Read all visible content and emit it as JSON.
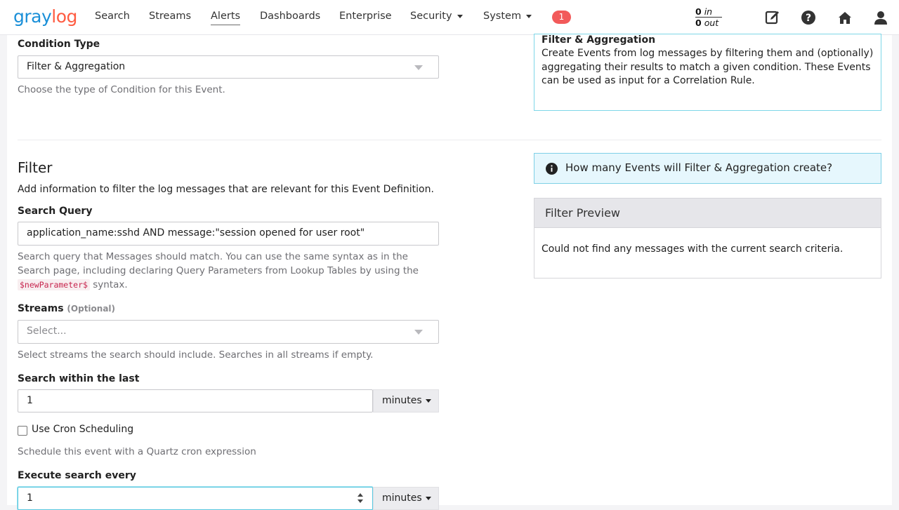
{
  "navbar": {
    "logo_main": "gray",
    "logo_accent": "log",
    "items": [
      "Search",
      "Streams",
      "Alerts",
      "Dashboards",
      "Enterprise",
      "Security",
      "System"
    ],
    "notification_count": "1",
    "throughput": {
      "in_value": "0",
      "in_label": "in",
      "out_value": "0",
      "out_label": "out"
    },
    "icons": [
      "edit-icon",
      "help-icon",
      "home-icon",
      "user-icon"
    ]
  },
  "condition": {
    "label": "Condition Type",
    "value": "Filter & Aggregation",
    "help": "Choose the type of Condition for this Event."
  },
  "condition_info": {
    "title": "Filter & Aggregation",
    "text": "Create Events from log messages by filtering them and (optionally) aggregating their results to match a given condition. These Events can be used as input for a Correlation Rule."
  },
  "filter": {
    "title": "Filter",
    "description": "Add information to filter the log messages that are relevant for this Event Definition.",
    "search_query": {
      "label": "Search Query",
      "value": "application_name:sshd AND message:\"session opened for user root\"",
      "help_before": "Search query that Messages should match. You can use the same syntax as in the Search page, including declaring Query Parameters from Lookup Tables by using the",
      "help_code": "$newParameter$",
      "help_after": "syntax."
    },
    "streams": {
      "label": "Streams",
      "optional": "(Optional)",
      "placeholder": "Select...",
      "help": "Select streams the search should include. Searches in all streams if empty."
    },
    "search_within": {
      "label": "Search within the last",
      "value": "1",
      "unit": "minutes"
    },
    "cron": {
      "label": "Use Cron Scheduling",
      "checked": false,
      "help": "Schedule this event with a Quartz cron expression"
    },
    "execute_every": {
      "label": "Execute search every",
      "value": "1",
      "unit": "minutes"
    }
  },
  "preview": {
    "alert": "How many Events will Filter & Aggregation create?",
    "title": "Filter Preview",
    "message": "Could not find any messages with the current search criteria."
  }
}
